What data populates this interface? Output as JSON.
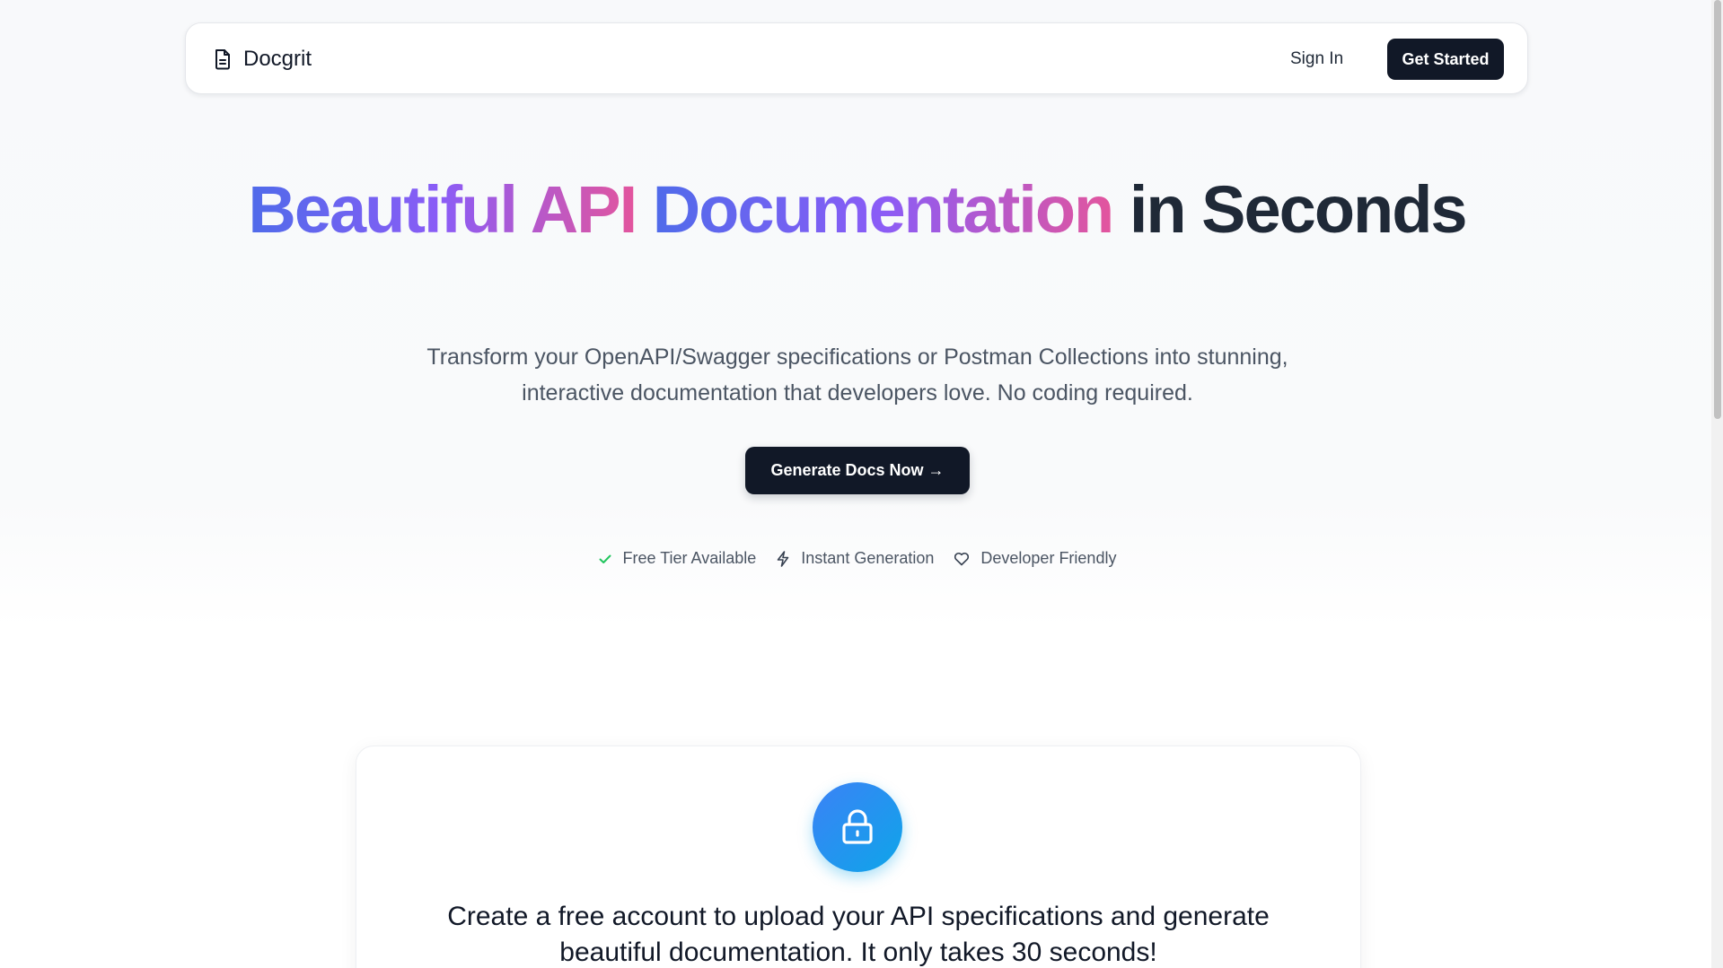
{
  "nav": {
    "brand": "Docgrit",
    "brand_icon": "document-icon",
    "sign_in": "Sign In",
    "get_started": "Get Started"
  },
  "hero": {
    "title_gradient_1": "Beautiful API",
    "title_gradient_2": "Documentation",
    "title_plain": "in Seconds",
    "subtitle": "Transform your OpenAPI/Swagger specifications or Postman Collections into stunning, interactive documentation that developers love. No coding required.",
    "cta": "Generate Docs Now →",
    "features": [
      {
        "icon": "check-icon",
        "label": "Free Tier Available"
      },
      {
        "icon": "lightning-icon",
        "label": "Instant Generation"
      },
      {
        "icon": "heart-icon",
        "label": "Developer Friendly"
      }
    ]
  },
  "card": {
    "icon": "lock-icon",
    "text": "Create a free account to upload your API specifications and generate beautiful documentation. It only takes 30 seconds!"
  },
  "colors": {
    "primary_dark": "#111827",
    "gradient_start": "#4f6bea",
    "gradient_mid": "#8b5cf6",
    "gradient_end": "#e3559d",
    "check_green": "#22c55e",
    "lock_blue": "#0ea5e9"
  }
}
